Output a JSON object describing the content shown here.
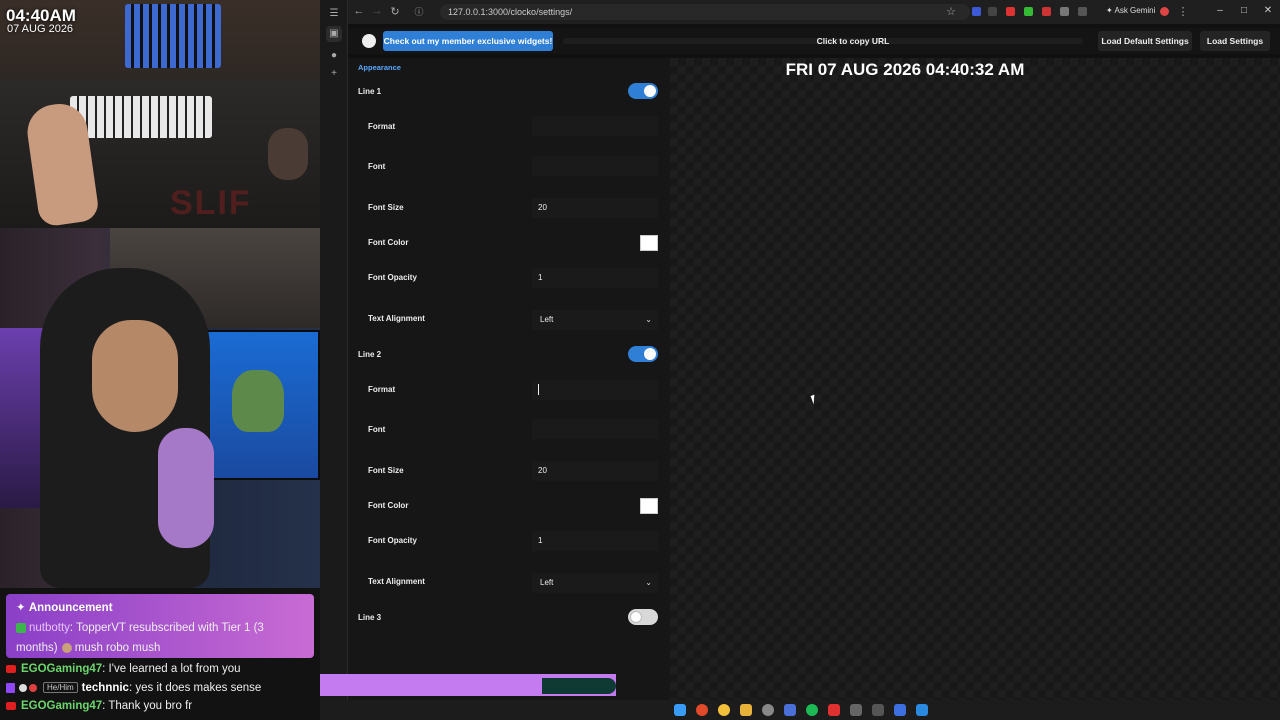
{
  "stream": {
    "clock_time": "04:40AM",
    "clock_date": "07 AUG 2026",
    "announcement_title": "Announcement",
    "announcement_user": "nutbotty",
    "announcement_text": ": TopperVT resubscribed with Tier 1 (3 months)",
    "announcement_text2": " mush robo mush",
    "chat": [
      {
        "user": "EGOGaming47",
        "platform": "youtube",
        "message": ": I've learned a lot from you"
      },
      {
        "user": "technnic",
        "platform": "twitch",
        "pronoun": "He/Him",
        "message": ": yes it does makes sense"
      },
      {
        "user": "EGOGaming47",
        "platform": "youtube",
        "message": ": Thank you bro fr"
      }
    ]
  },
  "browser": {
    "url": "127.0.0.1:3000/clocko/settings/",
    "ask_gemini": "Ask Gemini"
  },
  "topbar": {
    "member_button": "Check out my member exclusive widgets!",
    "copy_url": "Click to copy URL",
    "load_default": "Load Default Settings",
    "load_settings": "Load Settings"
  },
  "settings": {
    "section": "Appearance",
    "line1": {
      "label": "Line 1",
      "enabled": true,
      "format_label": "Format",
      "format_value": "",
      "font_label": "Font",
      "font_value": "",
      "size_label": "Font Size",
      "size_value": "20",
      "color_label": "Font Color",
      "color_value": "#ffffff",
      "opacity_label": "Font Opacity",
      "opacity_value": "1",
      "align_label": "Text Alignment",
      "align_value": "Left"
    },
    "line2": {
      "label": "Line 2",
      "enabled": true,
      "format_label": "Format",
      "format_value": "",
      "font_label": "Font",
      "font_value": "",
      "size_label": "Font Size",
      "size_value": "20",
      "color_label": "Font Color",
      "color_value": "#ffffff",
      "opacity_label": "Font Opacity",
      "opacity_value": "1",
      "align_label": "Text Alignment",
      "align_value": "Left"
    },
    "line3": {
      "label": "Line 3",
      "enabled": false
    }
  },
  "preview": {
    "clock_text": "FRI 07 AUG 2026 04:40:32 AM"
  },
  "colors": {
    "accent": "#2f7fd6",
    "link": "#5aa7ff",
    "chat_name": "#6bd66b"
  }
}
